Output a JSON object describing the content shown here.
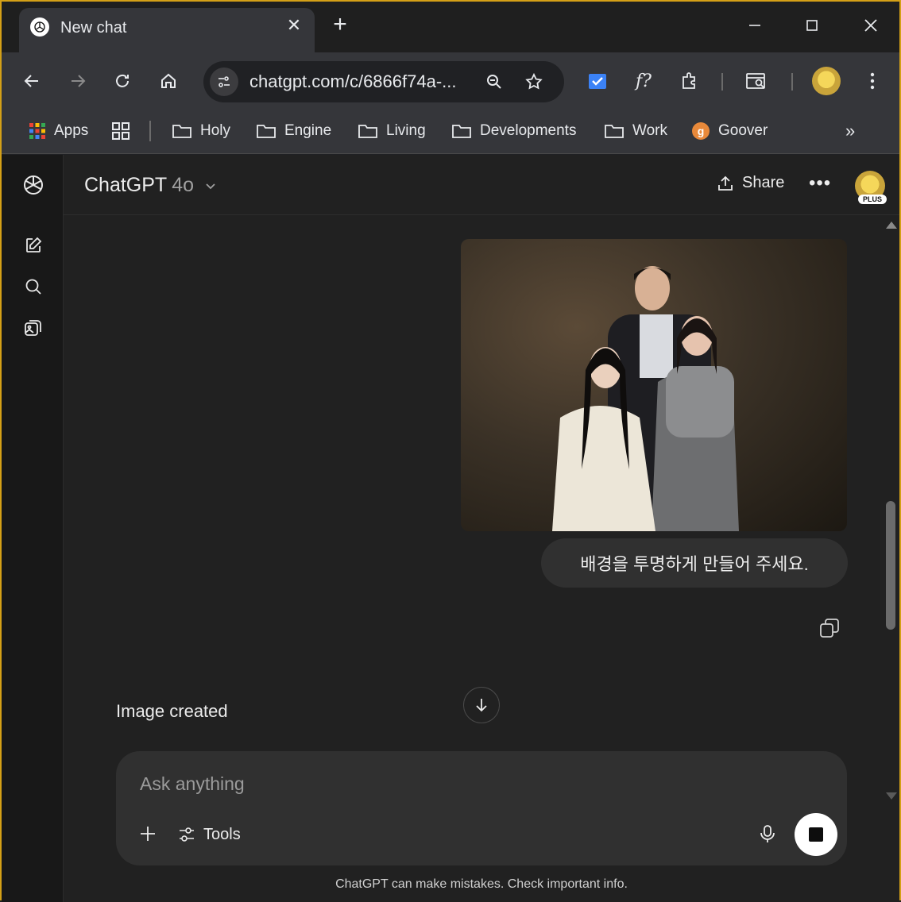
{
  "browser": {
    "tab_title": "New chat",
    "url": "chatgpt.com/c/6866f74a-...",
    "bookmarks": [
      {
        "label": "Apps"
      },
      {
        "label": "Holy"
      },
      {
        "label": "Engine"
      },
      {
        "label": "Living"
      },
      {
        "label": "Developments"
      },
      {
        "label": "Work"
      },
      {
        "label": "Goover"
      }
    ]
  },
  "header": {
    "model_name": "ChatGPT",
    "model_version": "4o",
    "share_label": "Share",
    "plan_badge": "PLUS"
  },
  "conversation": {
    "user_message": "배경을 투명하게 만들어 주세요.",
    "status_text": "Image created"
  },
  "composer": {
    "placeholder": "Ask anything",
    "tools_label": "Tools"
  },
  "footer": {
    "disclaimer": "ChatGPT can make mistakes. Check important info."
  },
  "colors": {
    "background": "#212121",
    "sidebar": "#181818",
    "composer": "#303030",
    "bubble": "#303030",
    "browser_chrome": "#35363a",
    "window_border": "#d4a017"
  }
}
